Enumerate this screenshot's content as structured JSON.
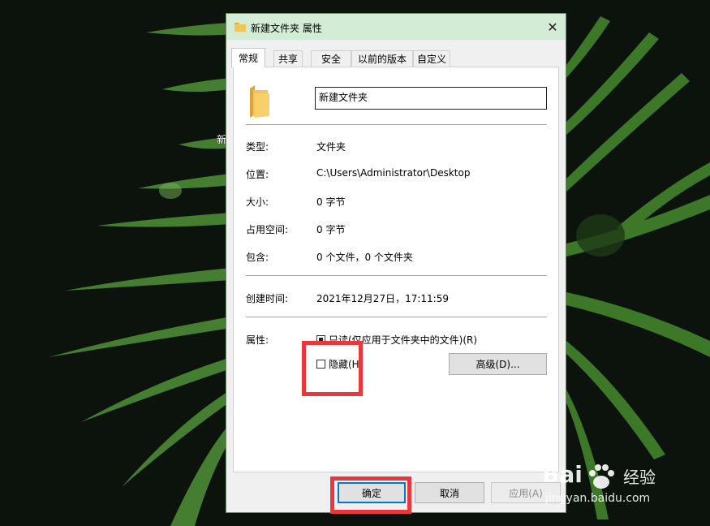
{
  "window": {
    "title": "新建文件夹 属性",
    "close_glyph": "✕"
  },
  "tabs": [
    {
      "label": "常规",
      "active": true
    },
    {
      "label": "共享"
    },
    {
      "label": "安全"
    },
    {
      "label": "以前的版本"
    },
    {
      "label": "自定义"
    }
  ],
  "general": {
    "folder_name": "新建文件夹",
    "type_label": "类型:",
    "type_value": "文件夹",
    "location_label": "位置:",
    "location_value": "C:\\Users\\Administrator\\Desktop",
    "size_label": "大小:",
    "size_value": "0 字节",
    "size_on_disk_label": "占用空间:",
    "size_on_disk_value": "0 字节",
    "contains_label": "包含:",
    "contains_value": "0 个文件，0 个文件夹",
    "created_label": "创建时间:",
    "created_value": "2021年12月27日，17:11:59",
    "attributes_label": "属性:",
    "readonly_label": "只读(仅应用于文件夹中的文件)(R)",
    "readonly_state": "indeterminate",
    "hidden_label": "隐藏(H",
    "hidden_checked": false,
    "advanced_button": "高级(D)..."
  },
  "footer": {
    "ok": "确定",
    "cancel": "取消",
    "apply": "应用(A)"
  },
  "desktop": {
    "partial_icon_label": "新"
  },
  "watermark": {
    "brand": "Bai",
    "brand2": "经验",
    "url": "jingyan.baidu.com"
  },
  "colors": {
    "titlebar": "#d3ecd6",
    "highlight_box": "#e8383d",
    "focus": "#0078d7",
    "folder": "#f4c35a"
  }
}
